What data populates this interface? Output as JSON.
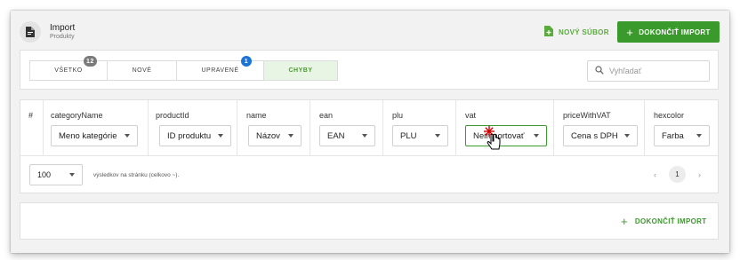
{
  "header": {
    "title": "Import",
    "subtitle": "Produkty",
    "icon": "file-icon",
    "new_file_label": "NOVÝ SÚBOR",
    "finish_label": "DOKONČIŤ IMPORT"
  },
  "tabs": [
    {
      "label": "VŠETKO",
      "badge": "12",
      "badge_color": "#7a7a7a",
      "active": false
    },
    {
      "label": "NOVÉ",
      "badge": "",
      "active": false
    },
    {
      "label": "UPRAVENÉ",
      "badge": "1",
      "badge_color": "#1a73d9",
      "active": false
    },
    {
      "label": "CHYBY",
      "badge": "",
      "active": true
    }
  ],
  "search": {
    "placeholder": "Vyhľadať"
  },
  "table": {
    "index_header": "#",
    "columns": [
      {
        "header": "categoryName",
        "value": "Meno kategórie"
      },
      {
        "header": "productId",
        "value": "ID produktu"
      },
      {
        "header": "name",
        "value": "Názov"
      },
      {
        "header": "ean",
        "value": "EAN"
      },
      {
        "header": "plu",
        "value": "PLU"
      },
      {
        "header": "vat",
        "value": "Neimportovať"
      },
      {
        "header": "priceWithVAT",
        "value": "Cena s DPH"
      },
      {
        "header": "hexcolor",
        "value": "Farba"
      }
    ]
  },
  "pagination": {
    "per_page": "100",
    "per_page_text": "výsledkov na stránku (celkovo ~).",
    "current_page": "1"
  },
  "footer": {
    "finish_label": "DOKONČIŤ IMPORT"
  },
  "colors": {
    "accent": "#3a9a2b",
    "accent_light": "#5aab3c"
  }
}
